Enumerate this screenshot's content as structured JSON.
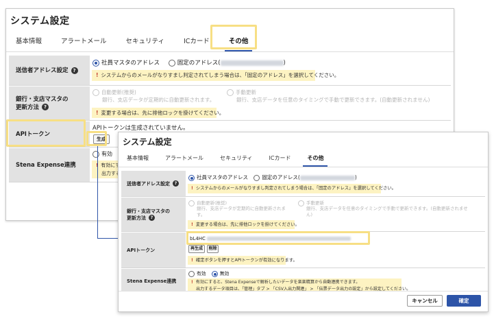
{
  "back": {
    "title": "システム設定",
    "tabs": [
      "基本情報",
      "アラートメール",
      "セキュリティ",
      "ICカード",
      "その他"
    ],
    "rows": {
      "sender": {
        "label": "送信者アドレス設定",
        "opt1": "社員マスタのアドレス",
        "opt2": "固定のアドレス(",
        "opt2_end": ")",
        "note": "システムからのメールがなりすまし判定されてしまう場合は、「固定のアドレス」を選択してください。"
      },
      "bank": {
        "label1": "銀行・支店マスタの",
        "label2": "更新方法",
        "opt1": "自動更新(推奨)",
        "opt1_desc": "銀行、支店データが定期的に自動更新されます。",
        "opt2": "手動更新",
        "opt2_desc": "銀行、支店データを任意のタイミングで手動で更新できます。(自動更新されません)",
        "note": "変更する場合は、先に排他ロックを掛けてください。"
      },
      "api": {
        "label": "APIトークン",
        "status": "APIトークンは生成されていません。",
        "generate": "生成"
      },
      "stena": {
        "label": "Stena Expense連携",
        "opt1": "有効",
        "note1": "有効にす",
        "note2": "出力する"
      }
    }
  },
  "front": {
    "title": "システム設定",
    "tabs": [
      "基本情報",
      "アラートメール",
      "セキュリティ",
      "ICカード",
      "その他"
    ],
    "rows": {
      "sender": {
        "label": "送信者アドレス設定",
        "opt1": "社員マスタのアドレス",
        "opt2": "固定のアドレス(",
        "opt2_end": ")",
        "note": "システムからのメールがなりすまし判定されてしまう場合は、「固定のアドレス」を選択してください。"
      },
      "bank": {
        "label1": "銀行・支店マスタの",
        "label2": "更新方法",
        "opt1": "自動更新(推奨)",
        "opt1_desc1": "銀行、支店データが定期的に自動更新されま",
        "opt1_desc2": "す。",
        "opt2": "手動更新",
        "opt2_desc1": "銀行、支店データを任意のタイミングで手動で更新できます。(自動更新されませ",
        "opt2_desc2": "ん)",
        "note": "変更する場合は、先に排他ロックを掛けてください。"
      },
      "api": {
        "label": "APIトークン",
        "token": "bL4HC",
        "regenerate": "再生成",
        "delete": "削除",
        "note": "確定ボタンを押すとAPIトークンが有効になります。"
      },
      "stena": {
        "label": "Stena Expense連携",
        "opt1": "有効",
        "opt2": "無効",
        "note1": "有効にすると、Stena Expenseで解析したいデータを楽楽精算から自動連携できます。",
        "note2": "出力するデータ項目は、「管理」タブ > 「CSV入出力関連」 > 「伝票データ出力の設定」から設定してください。"
      }
    },
    "footer": {
      "cancel": "キャンセル",
      "confirm": "確定"
    }
  }
}
